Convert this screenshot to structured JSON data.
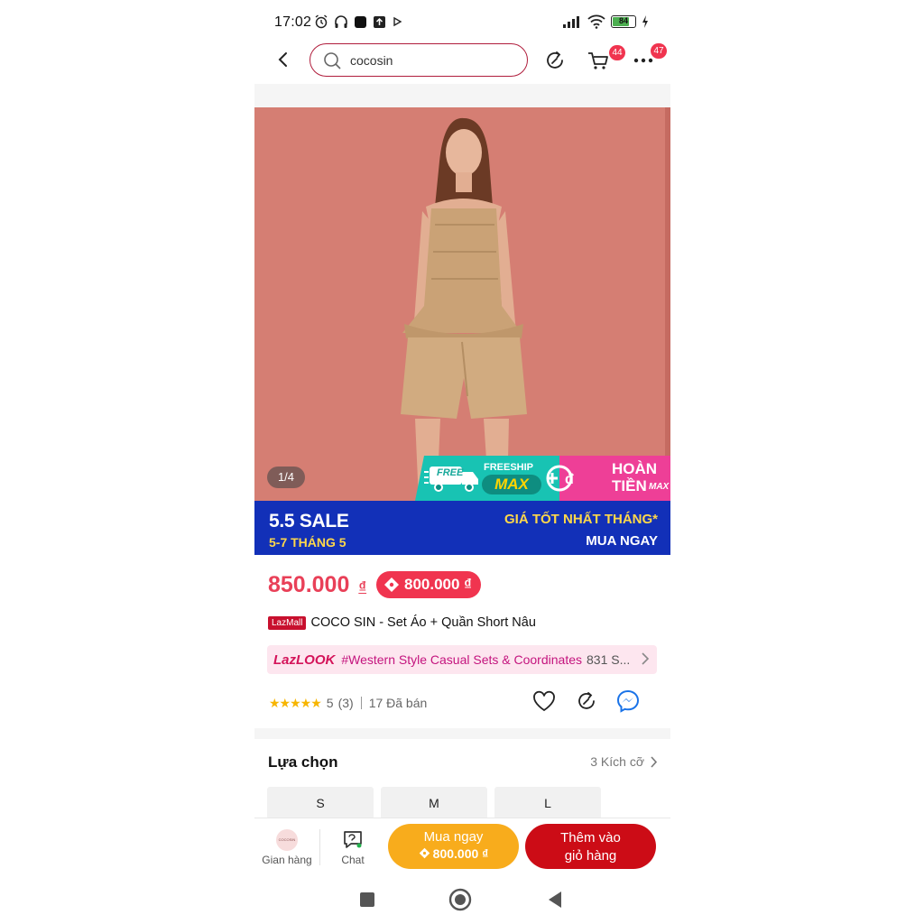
{
  "status_bar": {
    "time": "17:02",
    "battery_level": "84"
  },
  "header": {
    "search_value": "cocosin",
    "cart_badge": "44",
    "more_badge": "47"
  },
  "gallery": {
    "page_indicator": "1/4"
  },
  "promo_badges": {
    "free_label": "FREE",
    "freeship_label": "FREESHIP",
    "freeship_max": "MAX",
    "hoan_tien_line1": "HOÀN",
    "hoan_tien_line2": "TIỀN",
    "hoan_tien_max": "MAX"
  },
  "sale_banner": {
    "title": "5.5 SALE",
    "dates": "5-7 THÁNG 5",
    "tagline": "GIÁ TỐT NHẤT THÁNG*",
    "cta": "MUA NGAY"
  },
  "product": {
    "price": "850.000",
    "currency": "₫",
    "voucher_price": "800.000 ₫",
    "mall_badge": "LazMall",
    "title": "COCO SIN - Set Áo + Quần Short Nâu"
  },
  "lazlook": {
    "brand": "LazLOOK",
    "tag": "#Western Style Casual Sets & Coordinates",
    "count": "831 S..."
  },
  "rating": {
    "stars": "★★★★★",
    "score": "5",
    "reviews": "(3)",
    "sold": "17 Đã bán"
  },
  "options": {
    "heading": "Lựa chọn",
    "link": "3 Kích cỡ",
    "sizes": [
      "S",
      "M",
      "L"
    ]
  },
  "bottom_bar": {
    "store_label": "Gian hàng",
    "store_logo_text": "COCOSIN",
    "chat_label": "Chat",
    "buy_now_line1": "Mua ngay",
    "buy_now_line2": "800.000 ₫",
    "add_cart_line1": "Thêm vào",
    "add_cart_line2": "giỏ hàng"
  },
  "colors": {
    "accent_red": "#f0344f",
    "banner_blue": "#1230b8",
    "buy_orange": "#f8ac1c",
    "cart_red": "#cc0c16",
    "freeship_teal": "#18c3b3",
    "hoan_pink": "#ee3f97",
    "photo_backdrop": "#d57e73"
  }
}
